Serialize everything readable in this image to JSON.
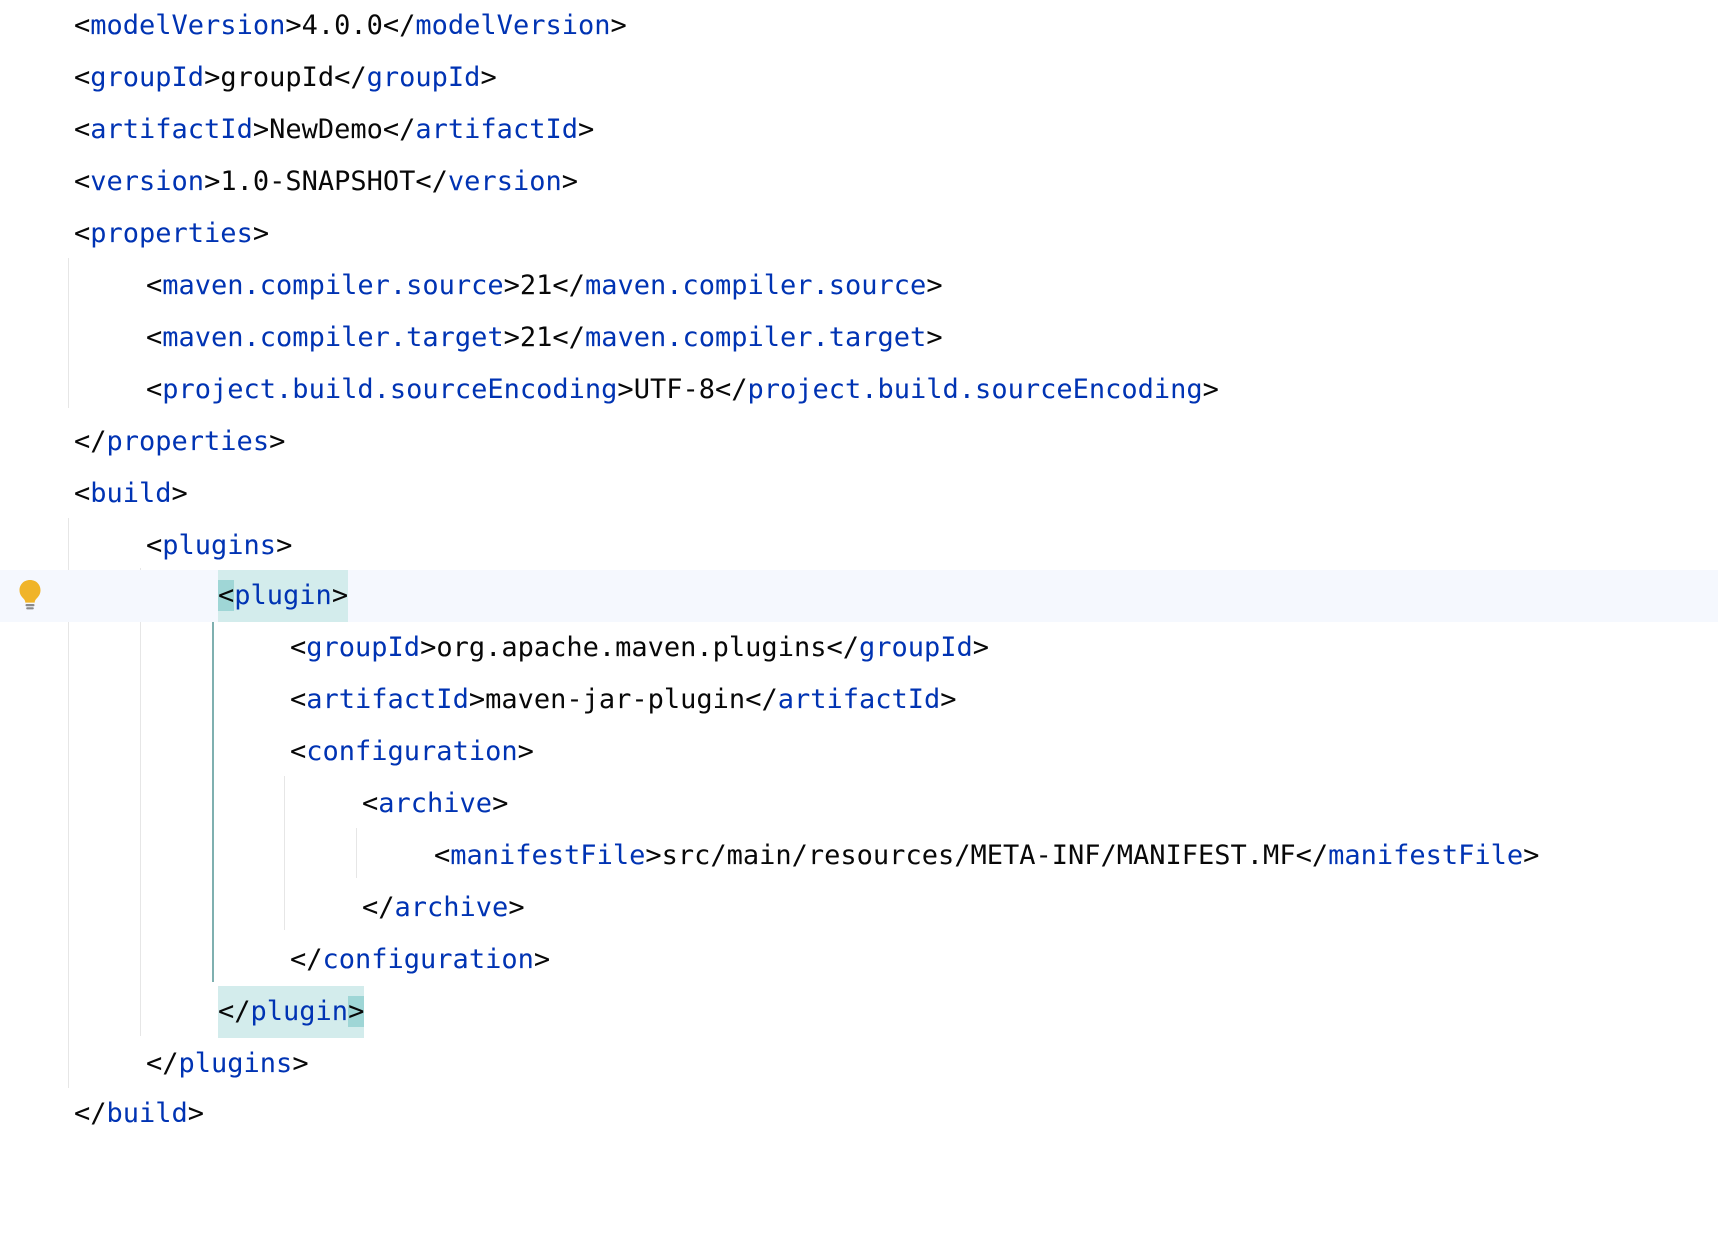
{
  "editor": {
    "language": "xml",
    "highlight_colors": {
      "tag": "#0033b3",
      "text": "#080808",
      "bracket_match": "#d3ecec",
      "caret_row": "#f5f8fe",
      "intention_bulb": "#f0b429"
    },
    "gutter_icons": [
      "lightbulb-icon"
    ],
    "lines": [
      {
        "open": "modelVersion",
        "text": "4.0.0",
        "close": "modelVersion"
      },
      {
        "open": "groupId",
        "text": "groupId",
        "close": "groupId"
      },
      {
        "open": "artifactId",
        "text": "NewDemo",
        "close": "artifactId"
      },
      {
        "open": "version",
        "text": "1.0-SNAPSHOT",
        "close": "version"
      },
      {
        "open": "properties"
      },
      {
        "open": "maven.compiler.source",
        "text": "21",
        "close": "maven.compiler.source"
      },
      {
        "open": "maven.compiler.target",
        "text": "21",
        "close": "maven.compiler.target"
      },
      {
        "open": "project.build.sourceEncoding",
        "text": "UTF-8",
        "close": "project.build.sourceEncoding"
      },
      {
        "close": "properties"
      },
      {
        "open": "build"
      },
      {
        "open": "plugins"
      },
      {
        "open": "plugin"
      },
      {
        "open": "groupId",
        "text": "org.apache.maven.plugins",
        "close": "groupId"
      },
      {
        "open": "artifactId",
        "text": "maven-jar-plugin",
        "close": "artifactId"
      },
      {
        "open": "configuration"
      },
      {
        "open": "archive"
      },
      {
        "open": "manifestFile",
        "text": "src/main/resources/META-INF/MANIFEST.MF",
        "close": "manifestFile"
      },
      {
        "close": "archive"
      },
      {
        "close": "configuration"
      },
      {
        "close": "plugin"
      },
      {
        "close": "plugins"
      },
      {
        "close": "build"
      }
    ]
  }
}
